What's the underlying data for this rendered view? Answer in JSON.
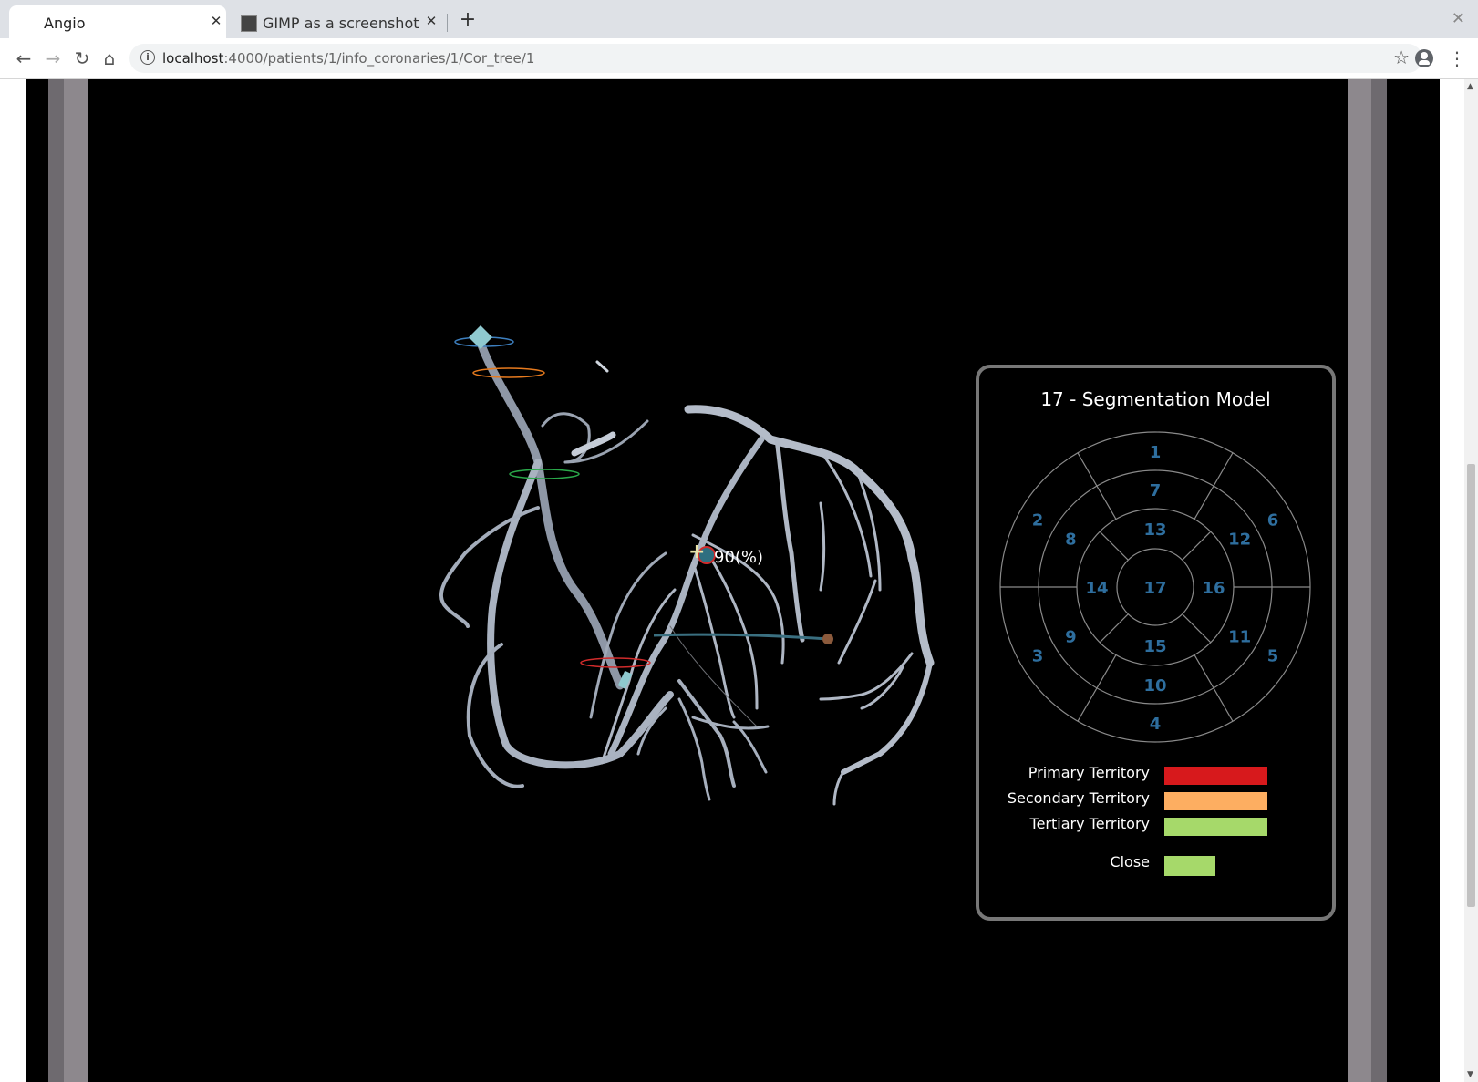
{
  "browser": {
    "tabs": [
      {
        "title": "Angio",
        "active": true
      },
      {
        "title": "GIMP as a screenshot t",
        "active": false
      }
    ],
    "new_tab_icon": "plus-icon",
    "address": {
      "host": "localhost",
      "path": ":4000/patients/1/info_coronaries/1/Cor_tree/1"
    }
  },
  "scene": {
    "stenosis_label": "90(%)",
    "vessel_color": "#b8c0cc"
  },
  "segmentation": {
    "title": "17 - Segmentation Model",
    "number_color": "#2e6e9e",
    "segments": [
      "1",
      "2",
      "3",
      "4",
      "5",
      "6",
      "7",
      "8",
      "9",
      "10",
      "11",
      "12",
      "13",
      "14",
      "15",
      "16",
      "17"
    ],
    "legend": [
      {
        "label": "Primary Territory",
        "color": "#d7191c"
      },
      {
        "label": "Secondary Territory",
        "color": "#fdae61"
      },
      {
        "label": "Tertiary Territory",
        "color": "#a6d96a"
      }
    ],
    "close_label": "Close",
    "close_color": "#a6d96a"
  }
}
